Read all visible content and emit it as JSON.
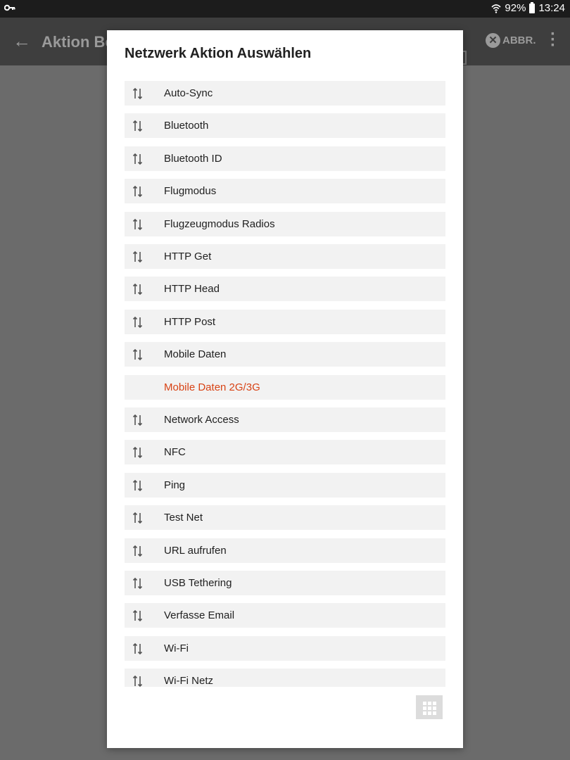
{
  "status_bar": {
    "battery": "92%",
    "time": "13:24",
    "key_icon": "key-icon",
    "wifi_icon": "wifi-icon",
    "battery_icon": "battery-icon"
  },
  "app_bar": {
    "title": "Aktion Be",
    "cancel_label": "ABBR.",
    "back_icon": "arrow-left-icon",
    "cancel_icon": "close-circle-icon",
    "menu_icon": "overflow-menu-icon"
  },
  "dialog": {
    "title": "Netzwerk Aktion Auswählen",
    "grid_button_icon": "grid-icon",
    "highlight_color": "#d84315",
    "items": [
      {
        "label": "Auto-Sync",
        "icon": "transfer-arrows-icon"
      },
      {
        "label": "Bluetooth",
        "icon": "transfer-arrows-icon"
      },
      {
        "label": "Bluetooth ID",
        "icon": "transfer-arrows-icon"
      },
      {
        "label": "Flugmodus",
        "icon": "transfer-arrows-icon"
      },
      {
        "label": "Flugzeugmodus Radios",
        "icon": "transfer-arrows-icon"
      },
      {
        "label": "HTTP Get",
        "icon": "transfer-arrows-icon"
      },
      {
        "label": "HTTP Head",
        "icon": "transfer-arrows-icon"
      },
      {
        "label": "HTTP Post",
        "icon": "transfer-arrows-icon"
      },
      {
        "label": "Mobile Daten",
        "icon": "transfer-arrows-icon"
      },
      {
        "label": "Mobile Daten 2G/3G",
        "icon": "",
        "highlighted": true
      },
      {
        "label": "Network Access",
        "icon": "transfer-arrows-icon"
      },
      {
        "label": "NFC",
        "icon": "transfer-arrows-icon"
      },
      {
        "label": "Ping",
        "icon": "transfer-arrows-icon"
      },
      {
        "label": "Test Net",
        "icon": "transfer-arrows-icon"
      },
      {
        "label": "URL aufrufen",
        "icon": "transfer-arrows-icon"
      },
      {
        "label": "USB Tethering",
        "icon": "transfer-arrows-icon"
      },
      {
        "label": "Verfasse Email",
        "icon": "transfer-arrows-icon"
      },
      {
        "label": "Wi-Fi",
        "icon": "transfer-arrows-icon"
      },
      {
        "label": "Wi-Fi Netz",
        "icon": "transfer-arrows-icon"
      }
    ]
  }
}
